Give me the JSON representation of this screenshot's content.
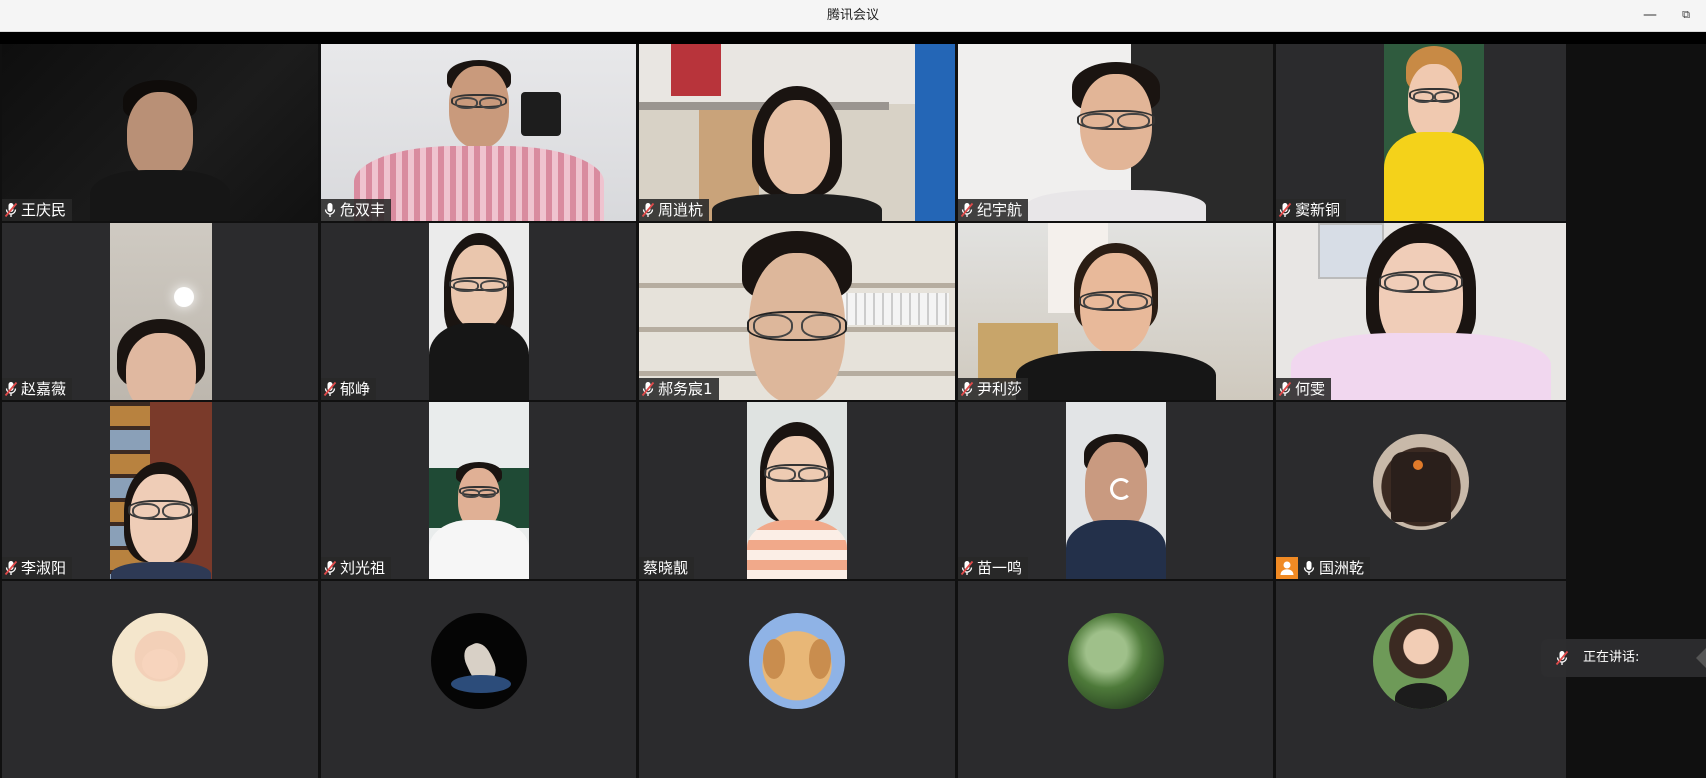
{
  "window": {
    "title": "腾讯会议",
    "minimize_glyph": "—",
    "restore_glyph": "⧉"
  },
  "participants": [
    {
      "name": "王庆民",
      "mic": "muted"
    },
    {
      "name": "危双丰",
      "mic": "on"
    },
    {
      "name": "周逍杭",
      "mic": "muted"
    },
    {
      "name": "纪宇航",
      "mic": "muted"
    },
    {
      "name": "窦新铜",
      "mic": "muted"
    },
    {
      "name": "赵嘉薇",
      "mic": "muted"
    },
    {
      "name": "郁峥",
      "mic": "muted"
    },
    {
      "name": "郝务宸1",
      "mic": "muted"
    },
    {
      "name": "尹利莎",
      "mic": "muted"
    },
    {
      "name": "何雯",
      "mic": "muted"
    },
    {
      "name": "李淑阳",
      "mic": "muted"
    },
    {
      "name": "刘光祖",
      "mic": "muted"
    },
    {
      "name": "蔡晓靓",
      "mic": "none"
    },
    {
      "name": "苗一鸣",
      "mic": "muted"
    },
    {
      "name": "国洲乾",
      "mic": "on",
      "host_icon": "person-icon"
    }
  ],
  "bottom_row_avatars": [
    "baby-avatar",
    "astronaut-avatar",
    "puppy-avatar",
    "tree-avatar",
    "woman-avatar"
  ],
  "speaking": {
    "label": "正在讲话:"
  },
  "colors": {
    "tile_bg": "#2b2b2d",
    "namebar_bg": "#282828",
    "muted_mic": "#e04b4b",
    "host_badge": "#f08a24"
  }
}
